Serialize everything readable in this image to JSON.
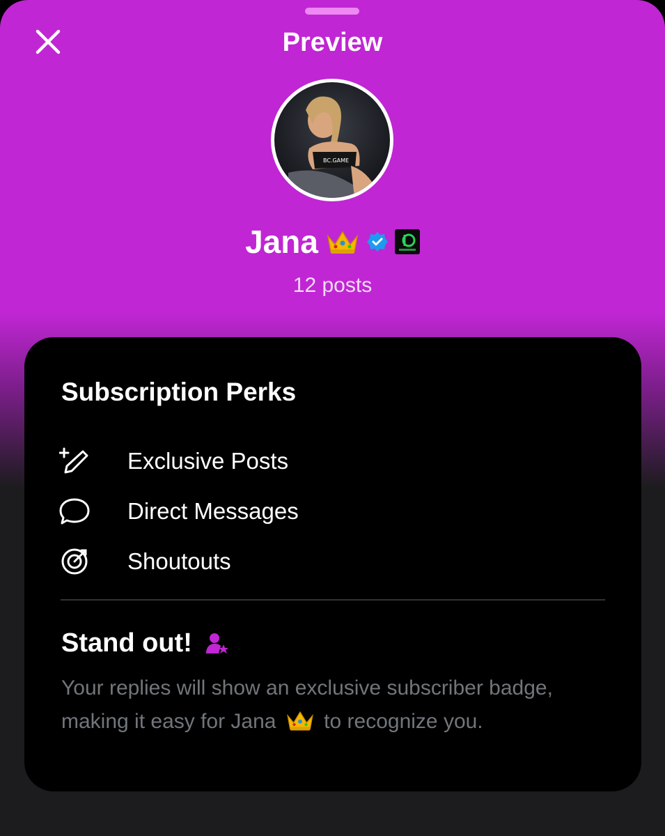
{
  "header": {
    "title": "Preview"
  },
  "profile": {
    "name": "Jana",
    "posts": "12 posts"
  },
  "perks": {
    "title": "Subscription Perks",
    "items": [
      {
        "label": "Exclusive Posts",
        "icon": "pen-plus-icon"
      },
      {
        "label": "Direct Messages",
        "icon": "chat-bubble-icon"
      },
      {
        "label": "Shoutouts",
        "icon": "target-icon"
      }
    ]
  },
  "standout": {
    "title": "Stand out!",
    "desc_part1": "Your replies will show an exclusive subscriber badge, making it easy for Jana",
    "desc_part2": "to recognize you."
  },
  "colors": {
    "header_bg": "#c026d3",
    "card_bg": "#000000",
    "accent": "#c026d3",
    "verified": "#1d9bf0",
    "muted_text": "#71767b"
  }
}
